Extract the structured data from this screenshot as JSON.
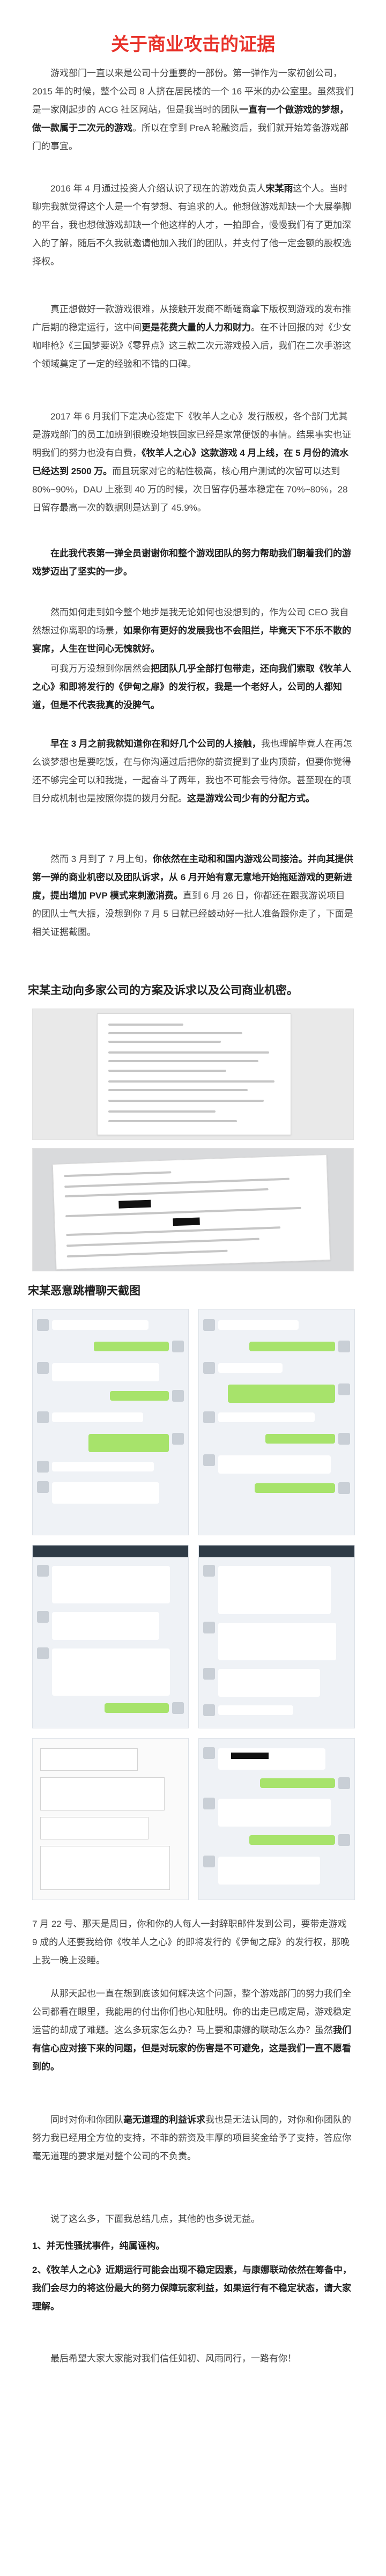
{
  "title": "关于商业攻击的证据",
  "paragraphs": {
    "p1_a": "游戏部门一直以来是公司十分重要的一部份。第一弹作为一家初创公司，2015 年的时候，整个公司 8 人挤在居民楼的一个 16 平米的办公室里。虽然我们是一家刚起步的 ACG 社区网站，但是我当时的团队",
    "p1_b": "一直有一个做游戏的梦想，做一款属于二次元的游戏",
    "p1_c": "。所以在拿到 PreA 轮融资后，我们就开始筹备游戏部门的事宜。",
    "p2_a": "2016 年 4 月通过投资人介绍认识了现在的游戏负责人",
    "p2_b": "宋某雨",
    "p2_c": "这个人。当时聊完我就觉得这个人是一个有梦想、有追求的人。他想做游戏却缺一个大展拳脚的平台，我也想做游戏却缺一个他这样的人才，一拍即合，慢慢我们有了更加深入的了解，随后不久我就邀请他加入我们的团队，并支付了他一定金额的股权选择权。",
    "p3_a": "真正想做好一款游戏很难，从接触开发商不断磋商拿下版权到游戏的发布推广后期的稳定运行，这中间",
    "p3_b": "更是花费大量的人力和财力",
    "p3_c": "。在不计回报的对《少女咖啡枪》《三国梦要说》《零界点》这三款二次元游戏投入后，我们在二次手游这个领域奠定了一定的经验和不错的口碑。",
    "p4_a": "2017 年 6 月我们下定决心签定下《牧羊人之心》发行版权，各个部门尤其是游戏部门的员工加班到很晚没地铁回家已经是家常便饭的事情。结果事实也证明我们的努力也没有白费，",
    "p4_b": "《牧羊人之心》这款游戏 4 月上线，在 5 月份的流水已经达到 2500 万。",
    "p4_c": "而且玩家对它的粘性极高，核心用户测试的次留可以达到 80%~90%，DAU 上涨到 40 万的时候，次日留存仍基本稳定在 70%~80%，28 日留存最高一次的数据则是达到了 45.9%。",
    "p5": "在此我代表第一弹全员谢谢你和整个游戏团队的努力帮助我们朝着我们的游戏梦迈出了坚实的一步。",
    "p6_a": "然而如何走到如今整个地步是我无论如何也没想到的，作为公司 CEO 我自然想过你离职的场景，",
    "p6_b": "如果你有更好的发展我也不会阻拦，毕竟天下不乐不散的宴席，人生在世问心无愧就好。",
    "p7_a": "可我万万没想到你居然会",
    "p7_b": "把团队几乎全部打包带走，还向我们索取《牧羊人之心》和即将发行的《伊甸之扉》的发行权，我是一个老好人，公司的人都知道，但是不代表我真的没脾气。",
    "p8_a": "早在 3 月之前我就知道你在和好几个公司的人接触，",
    "p8_b": "我也理解毕竟人在再怎么谈梦想也是要吃饭，在与你沟通过后把你的薪资提到了业内顶薪，但要你觉得还不够完全可以和我提，一起奋斗了两年，我也不可能会亏待你。甚至现在的项目分成机制也是按照你提的拨月分配。",
    "p8_c": "这是游戏公司少有的分配方式。",
    "p9_a": "然而 3 月到了 7 月上旬，",
    "p9_b": "你依然在主动和和国内游戏公司接洽。并向其提供第一弹的商业机密以及团队诉求，从 6 月开始有意无意地开始拖延游戏的更新进度，提出增加 PVP 模式来刺激消费。",
    "p9_c": "直到 6 月 26 日，你都还在跟我游说项目的团队士气大振，没想到你 7 月 5 日就已经鼓动好一批人准备跟你走了，下面是相关证据截图。"
  },
  "section1_title": "宋某主动向多家公司的方案及诉求以及公司商业机密。",
  "section2_title": "宋某恶意跳槽聊天截图",
  "paragraphs2": {
    "p10": "7 月 22 号、那天是周日，你和你的人每人一封辞职邮件发到公司，要带走游戏 9 成的人还要我给你《牧羊人之心》的即将发行的《伊甸之扉》的发行权，那晚上我一晚上没睡。",
    "p11_a": "从那天起也一直在想到底该如何解决这个问题，整个游戏部门的努力我们全公司都看在眼里，我能用的付出你们也心知肚明。你的出走已成定局，游戏稳定运营的却成了难题。这么多玩家怎么办？马上要和康娜的联动怎么办？虽然",
    "p11_b": "我们有信心应对接下来的问题，但是对玩家的伤害是不可避免，这是我们一直不愿看到的。",
    "p12_a": "同时对你和你团队",
    "p12_b": "毫无道理的利益诉求",
    "p12_c": "我也是无法认同的，对你和你团队的努力我已经用全方位的支持，不菲的薪资及丰厚的项目奖金给予了支持，答应你毫无道理的要求是对整个公司的不负责。",
    "p13": "说了这么多，下面我总结几点，其他的也多说无益。",
    "p14": "1、并无性骚扰事件，纯属诬构。",
    "p15": "2、《牧羊人之心》近期运行可能会出现不稳定因素，与康娜联动依然在筹备中，我们会尽力的将这份最大的努力保障玩家利益，如果运行有不稳定状态，请大家理解。",
    "p16": "最后希望大家大家能对我们信任如初、风雨同行，一路有你！"
  }
}
